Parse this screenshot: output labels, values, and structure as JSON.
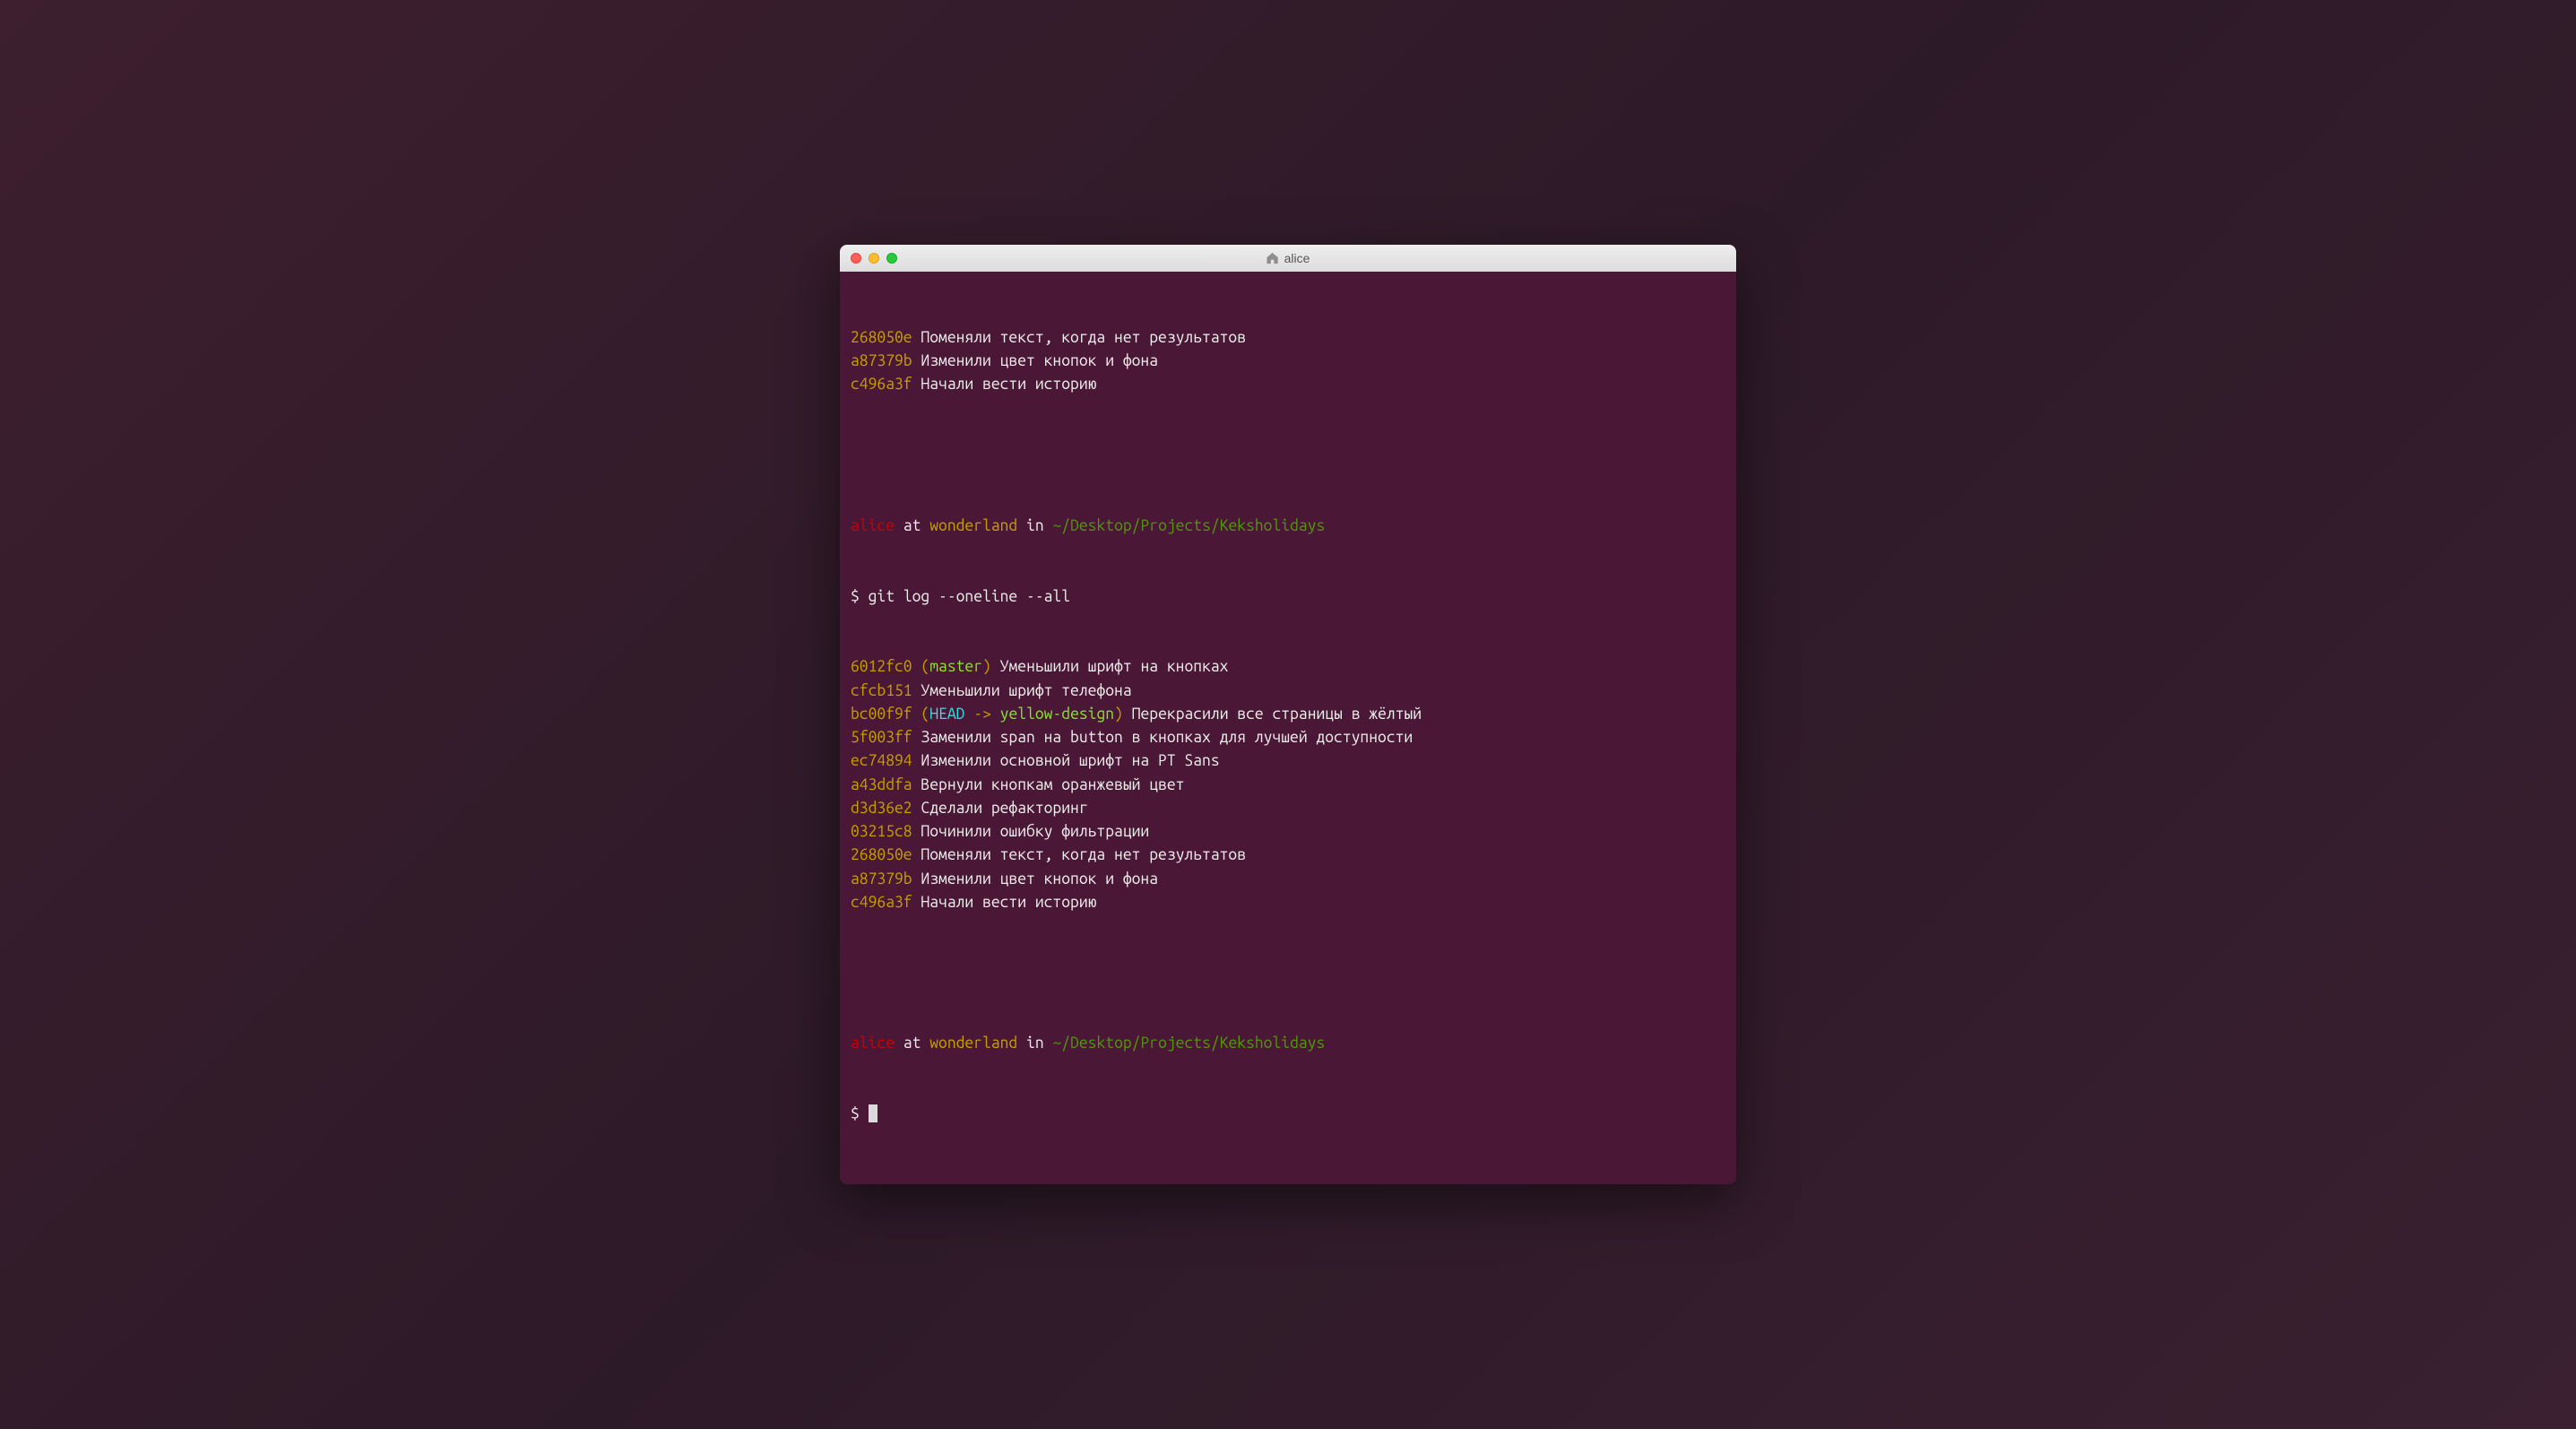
{
  "window": {
    "title": "alice"
  },
  "prompt": {
    "user": "alice",
    "at_word": "at",
    "host": "wonderland",
    "in_word": "in",
    "path": "~/Desktop/Projects/Keksholidays",
    "symbol": "$"
  },
  "top_commits": [
    {
      "hash": "268050e",
      "msg": "Поменяли текст, когда нет результатов"
    },
    {
      "hash": "a87379b",
      "msg": "Изменили цвет кнопок и фона"
    },
    {
      "hash": "c496a3f",
      "msg": "Начали вести историю"
    }
  ],
  "command": "git log --oneline --all",
  "log_commits": [
    {
      "hash": "6012fc0",
      "refs": {
        "type": "branch",
        "branch": "master"
      },
      "msg": "Уменьшили шрифт на кнопках"
    },
    {
      "hash": "cfcb151",
      "msg": "Уменьшили шрифт телефона"
    },
    {
      "hash": "bc00f9f",
      "refs": {
        "type": "head",
        "head": "HEAD",
        "arrow": "->",
        "branch": "yellow-design"
      },
      "msg": "Перекрасили все страницы в жёлтый"
    },
    {
      "hash": "5f003ff",
      "msg": "Заменили span на button в кнопках для лучшей доступности"
    },
    {
      "hash": "ec74894",
      "msg": "Изменили основной шрифт на PT Sans"
    },
    {
      "hash": "a43ddfa",
      "msg": "Вернули кнопкам оранжевый цвет"
    },
    {
      "hash": "d3d36e2",
      "msg": "Сделали рефакторинг"
    },
    {
      "hash": "03215c8",
      "msg": "Починили ошибку фильтрации"
    },
    {
      "hash": "268050e",
      "msg": "Поменяли текст, когда нет результатов"
    },
    {
      "hash": "a87379b",
      "msg": "Изменили цвет кнопок и фона"
    },
    {
      "hash": "c496a3f",
      "msg": "Начали вести историю"
    }
  ]
}
